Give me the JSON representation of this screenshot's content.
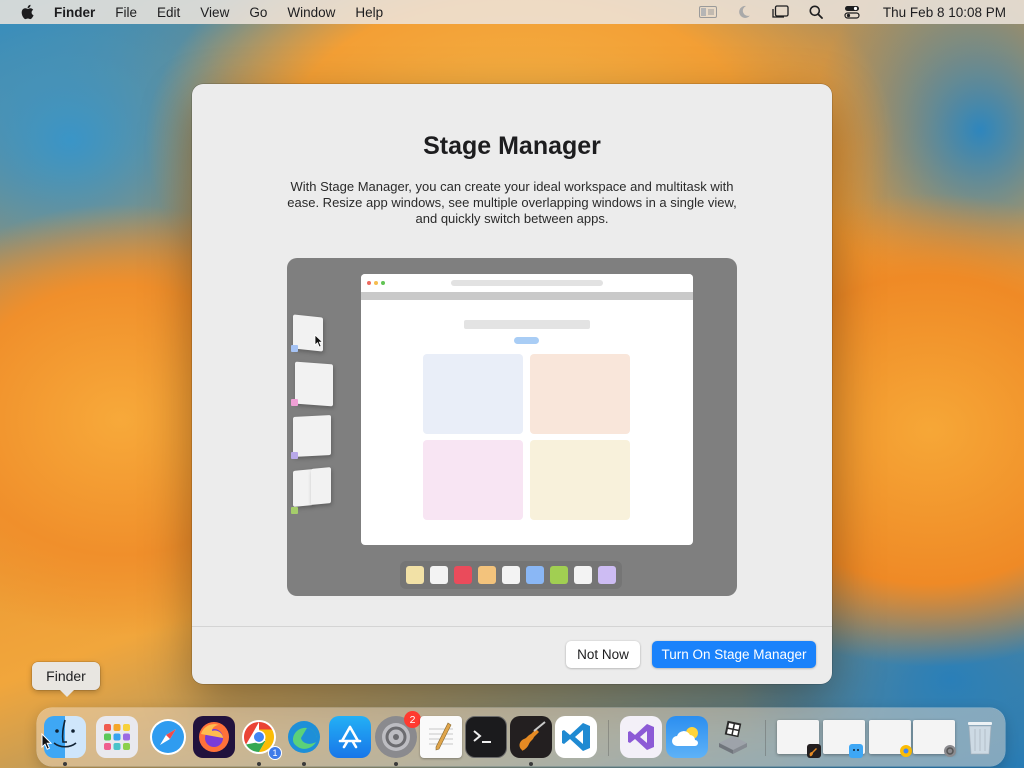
{
  "menubar": {
    "app_name": "Finder",
    "items": [
      "File",
      "Edit",
      "View",
      "Go",
      "Window",
      "Help"
    ],
    "status_icons": [
      "display-icon",
      "moon-icon",
      "stage-manager-icon",
      "spotlight-search-icon",
      "control-center-icon"
    ],
    "clock": "Thu Feb 8  10:08 PM"
  },
  "dialog": {
    "title": "Stage Manager",
    "description": "With Stage Manager, you can create your ideal workspace and multitask with ease. Resize app windows, see multiple overlapping windows in a single view, and quickly switch between apps.",
    "secondary_button": "Not Now",
    "primary_button": "Turn On Stage Manager"
  },
  "illustration": {
    "tile_colors": [
      "#e9eef8",
      "#f9e6da",
      "#f8e5f3",
      "#f8f1db"
    ],
    "stage_tag_colors": [
      "#a5c3f5",
      "#f0a0d6",
      "#b9a9ea",
      "#a5cd6a"
    ],
    "dock_colors": [
      "#f2e1a6",
      "#f3f3f3",
      "#ea4b5b",
      "#f3c37c",
      "#f3f3f3",
      "#8ab7f5",
      "#a1cf52",
      "#f3f3f3",
      "#cdbcf3"
    ]
  },
  "tooltip": {
    "label": "Finder"
  },
  "dock": {
    "badge_count": "2",
    "chrome_badge": "1",
    "apps": [
      "Finder",
      "Launchpad",
      "Safari",
      "Firefox",
      "Google Chrome",
      "Microsoft Edge",
      "App Store",
      "System Settings",
      "TextEdit",
      "Terminal",
      "GarageBand",
      "Visual Studio Code",
      "Visual Studio",
      "Weather",
      "Boot Camp",
      "Trash"
    ]
  },
  "colors": {
    "accent": "#1a82fb",
    "dialog_bg": "#ececec"
  }
}
